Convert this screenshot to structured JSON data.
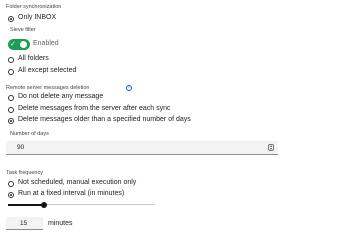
{
  "folder_sync": {
    "label": "Folder synchronization",
    "options": [
      {
        "label": "Only INBOX",
        "selected": true
      }
    ]
  },
  "sieve": {
    "label": "Sieve filter",
    "toggle_label": "Enabled",
    "enabled": true,
    "options": [
      {
        "label": "All folders",
        "selected": false
      },
      {
        "label": "All except selected",
        "selected": false
      }
    ]
  },
  "remote_deletion": {
    "label": "Remote server messages deletion",
    "options": [
      {
        "label": "Do not delete any message",
        "selected": false
      },
      {
        "label": "Delete messages from the server after each sync",
        "selected": false
      },
      {
        "label": "Delete messages older than a specified number of days",
        "selected": true
      }
    ],
    "days_label": "Number of days",
    "days_value": "90"
  },
  "task_frequency": {
    "label": "Task frequency",
    "options": [
      {
        "label": "Not scheduled, manual execution only",
        "selected": false
      },
      {
        "label": "Run at a fixed interval (in minutes)",
        "selected": true
      }
    ],
    "interval_value": "15",
    "interval_unit": "minutes"
  },
  "colors": {
    "toggle_on": "#1f9d55",
    "info": "#0f62fe"
  },
  "icons": {
    "info": "info-icon",
    "stepper": "stepper-icon",
    "check": "check-icon"
  }
}
